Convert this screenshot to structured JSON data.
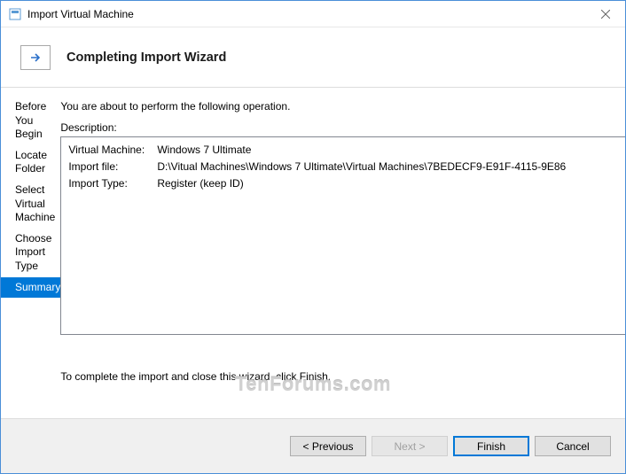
{
  "window": {
    "title": "Import Virtual Machine"
  },
  "header": {
    "title": "Completing Import Wizard"
  },
  "sidebar": {
    "items": [
      {
        "label": "Before You Begin"
      },
      {
        "label": "Locate Folder"
      },
      {
        "label": "Select Virtual Machine"
      },
      {
        "label": "Choose Import Type"
      },
      {
        "label": "Summary"
      }
    ],
    "active_index": 4
  },
  "content": {
    "intro": "You are about to perform the following operation.",
    "description_label": "Description:",
    "rows": [
      {
        "key": "Virtual Machine:",
        "value": "Windows 7 Ultimate"
      },
      {
        "key": "Import file:",
        "value": "D:\\Vitual Machines\\Windows 7 Ultimate\\Virtual Machines\\7BEDECF9-E91F-4115-9E86"
      },
      {
        "key": "Import Type:",
        "value": "Register (keep ID)"
      }
    ],
    "instruction": "To complete the import and close this wizard, click Finish."
  },
  "buttons": {
    "previous": "< Previous",
    "next": "Next >",
    "finish": "Finish",
    "cancel": "Cancel"
  },
  "watermark": "TenForums.com"
}
